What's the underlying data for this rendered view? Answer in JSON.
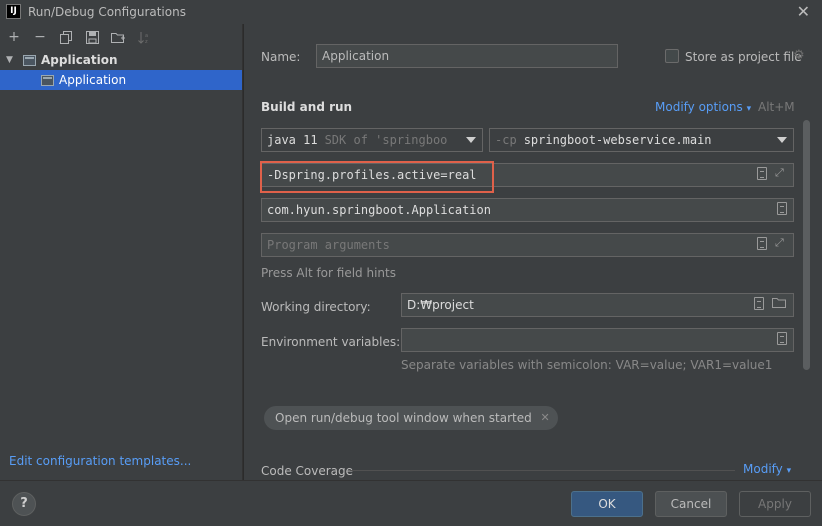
{
  "window": {
    "title": "Run/Debug Configurations",
    "app_icon_text": "IJ"
  },
  "sidebar": {
    "tree_parent": "Application",
    "tree_child": "Application",
    "edit_templates_link": "Edit configuration templates..."
  },
  "form": {
    "name_label": "Name:",
    "name_value": "Application",
    "store_as_project_label": "Store as project file",
    "store_as_project_checked": false,
    "section_title": "Build and run",
    "modify_options_label": "Modify options",
    "modify_options_shortcut": "Alt+M",
    "jdk_value": "java 11",
    "jdk_detail": "SDK of 'springboot-w",
    "cp_prefix": "-cp",
    "cp_value": "springboot-webservice.main",
    "vm_options_value": "-Dspring.profiles.active=real",
    "main_class_value": "com.hyun.springboot.Application",
    "program_args_placeholder": "Program arguments",
    "hint_text": "Press Alt for field hints",
    "working_dir_label": "Working directory:",
    "working_dir_value": "D:₩project",
    "env_vars_label": "Environment variables:",
    "env_vars_value": "",
    "env_vars_hint": "Separate variables with semicolon: VAR=value; VAR1=value1",
    "chip_label": "Open run/debug tool window when started",
    "code_coverage_label": "Code Coverage",
    "code_coverage_modify": "Modify"
  },
  "footer": {
    "help_label": "?",
    "ok_label": "OK",
    "cancel_label": "Cancel",
    "apply_label": "Apply"
  },
  "colors": {
    "accent_blue": "#589df6",
    "selection": "#2f65ca",
    "highlight_box": "#e0614a",
    "ok_button": "#365880"
  }
}
